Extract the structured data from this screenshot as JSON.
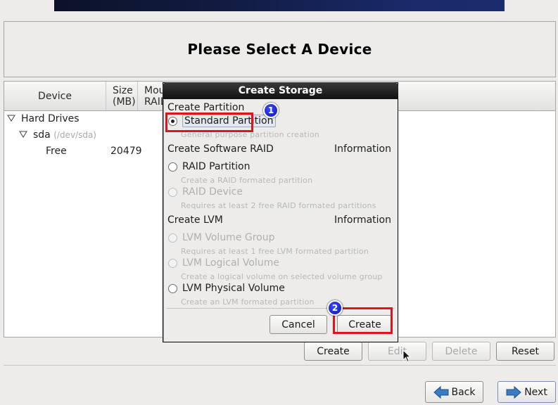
{
  "header": {
    "title": "Please Select A Device"
  },
  "tree": {
    "columns": [
      "Device",
      "Size\n(MB)",
      "Mount Point/\nRAID"
    ],
    "column_device": "Device",
    "column_size_l1": "Size",
    "column_size_l2": "(MB)",
    "column_mount_l1": "Mou",
    "column_mount_l2": "RAID",
    "rows": [
      {
        "label": "Hard Drives",
        "level": 0,
        "expanded": true
      },
      {
        "label": "sda",
        "detail": "(/dev/sda)",
        "level": 1,
        "expanded": true
      },
      {
        "label": "Free",
        "size": "20479",
        "level": 2
      }
    ]
  },
  "actions": {
    "create": "Create",
    "edit": "Edit",
    "delete": "Delete",
    "reset": "Reset"
  },
  "nav": {
    "back": "Back",
    "next": "Next"
  },
  "dialog": {
    "title": "Create Storage",
    "sections": [
      {
        "label": "Create Partition",
        "options": [
          {
            "label": "Standard Partition",
            "hint": "General purpose partition creation",
            "selected": true,
            "enabled": true
          }
        ]
      },
      {
        "label": "Create Software RAID",
        "info": "Information",
        "options": [
          {
            "label": "RAID Partition",
            "hint": "Create a RAID formated partition",
            "selected": false,
            "enabled": true
          },
          {
            "label": "RAID Device",
            "hint": "Requires at least 2 free RAID formated partitions",
            "selected": false,
            "enabled": false
          }
        ]
      },
      {
        "label": "Create LVM",
        "info": "Information",
        "options": [
          {
            "label": "LVM Volume Group",
            "hint": "Requires at least 1 free LVM formated partition",
            "selected": false,
            "enabled": false
          },
          {
            "label": "LVM Logical Volume",
            "hint": "Create a logical volume on selected volume group",
            "selected": false,
            "enabled": false
          },
          {
            "label": "LVM Physical Volume",
            "hint": "Create an LVM formated partition",
            "selected": false,
            "enabled": true
          }
        ]
      }
    ],
    "cancel": "Cancel",
    "create": "Create"
  },
  "annotations": {
    "step1": "1",
    "step2": "2",
    "highlight_color": "#e0141a",
    "badge_color": "#0a12b8"
  }
}
